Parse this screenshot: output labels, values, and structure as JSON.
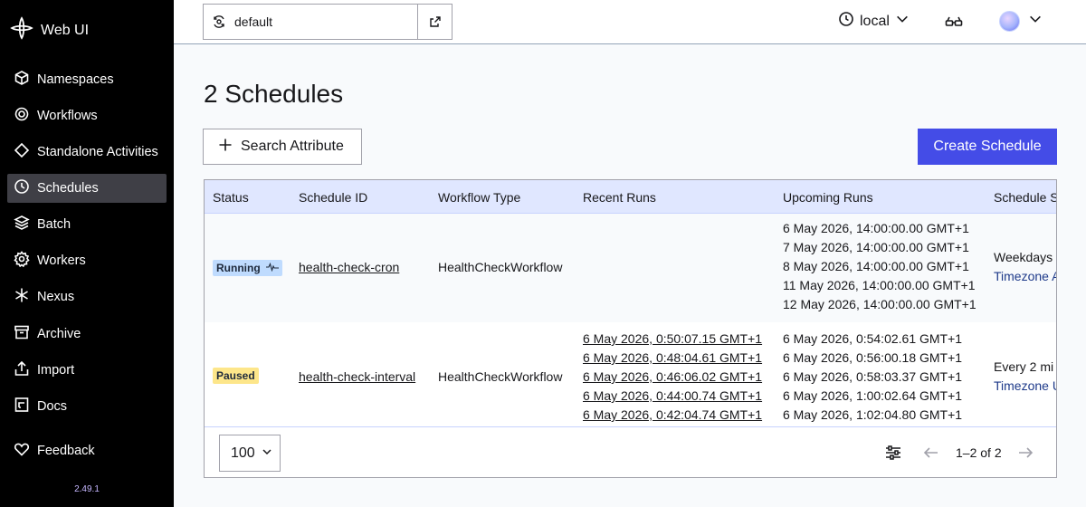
{
  "app": {
    "name": "Web UI",
    "version": "2.49.1"
  },
  "sidebar": {
    "items": [
      {
        "label": "Namespaces",
        "icon": "cube-icon"
      },
      {
        "label": "Workflows",
        "icon": "workflow-icon"
      },
      {
        "label": "Standalone Activities",
        "icon": "diamond-icon"
      },
      {
        "label": "Schedules",
        "icon": "schedule-icon",
        "active": true
      },
      {
        "label": "Batch",
        "icon": "batch-icon"
      },
      {
        "label": "Workers",
        "icon": "gear-icon"
      },
      {
        "label": "Nexus",
        "icon": "nexus-icon"
      },
      {
        "label": "Archive",
        "icon": "archive-icon"
      },
      {
        "label": "Import",
        "icon": "import-icon"
      },
      {
        "label": "Docs",
        "icon": "docs-icon"
      }
    ],
    "feedback": "Feedback"
  },
  "topbar": {
    "namespace": "default",
    "timezone": "local"
  },
  "main": {
    "title": "2 Schedules",
    "search_attribute_label": "Search Attribute",
    "create_label": "Create Schedule",
    "columns": [
      "Status",
      "Schedule ID",
      "Workflow Type",
      "Recent Runs",
      "Upcoming Runs",
      "Schedule S"
    ],
    "rows": [
      {
        "status": "Running",
        "schedule_id": "health-check-cron",
        "workflow_type": "HealthCheckWorkflow",
        "recent_runs": [],
        "upcoming_runs": [
          "6 May 2026, 14:00:00.00 GMT+1",
          "7 May 2026, 14:00:00.00 GMT+1",
          "8 May 2026, 14:00:00.00 GMT+1",
          "11 May 2026, 14:00:00.00 GMT+1",
          "12 May 2026, 14:00:00.00 GMT+1"
        ],
        "spec": "Weekdays",
        "spec_tz": "Timezone A"
      },
      {
        "status": "Paused",
        "schedule_id": "health-check-interval",
        "workflow_type": "HealthCheckWorkflow",
        "recent_runs": [
          "6 May 2026, 0:50:07.15 GMT+1",
          "6 May 2026, 0:48:04.61 GMT+1",
          "6 May 2026, 0:46:06.02 GMT+1",
          "6 May 2026, 0:44:00.74 GMT+1",
          "6 May 2026, 0:42:04.74 GMT+1"
        ],
        "upcoming_runs": [
          "6 May 2026, 0:54:02.61 GMT+1",
          "6 May 2026, 0:56:00.18 GMT+1",
          "6 May 2026, 0:58:03.37 GMT+1",
          "6 May 2026, 1:00:02.64 GMT+1",
          "6 May 2026, 1:02:04.80 GMT+1"
        ],
        "spec": "Every 2 mi",
        "spec_tz": "Timezone U"
      }
    ],
    "pagination": {
      "page_size": "100",
      "info": "1–2 of 2"
    }
  },
  "colors": {
    "accent": "#444ce7",
    "sidebar_bg": "#000000",
    "header_bg": "#e0e7ff",
    "running_badge": "#bfdbfe",
    "paused_badge": "#fde68a"
  }
}
